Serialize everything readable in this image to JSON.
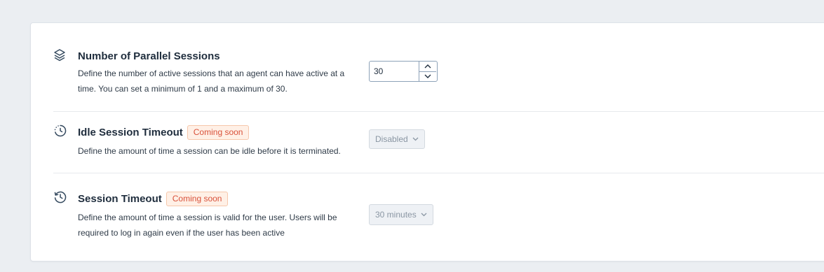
{
  "settings": {
    "parallel_sessions": {
      "icon": "layers-icon",
      "title": "Number of Parallel Sessions",
      "description": "Define the number of active sessions that an agent can have active at a time. You can set a minimum of 1 and a maximum of 30.",
      "value": "30"
    },
    "idle_timeout": {
      "icon": "idle-clock-icon",
      "title": "Idle Session Timeout",
      "badge": "Coming soon",
      "description": "Define the amount of time a session can be idle before it is terminated.",
      "selected": "Disabled"
    },
    "session_timeout": {
      "icon": "history-clock-icon",
      "title": "Session Timeout",
      "badge": "Coming soon",
      "description": "Define the amount of time a session is valid for the user. Users will be required to log in again even if the user has been active",
      "selected": "30 minutes"
    }
  },
  "colors": {
    "badge_text": "#d9513a",
    "badge_bg": "#fff0e6",
    "page_bg": "#ebeef2"
  }
}
